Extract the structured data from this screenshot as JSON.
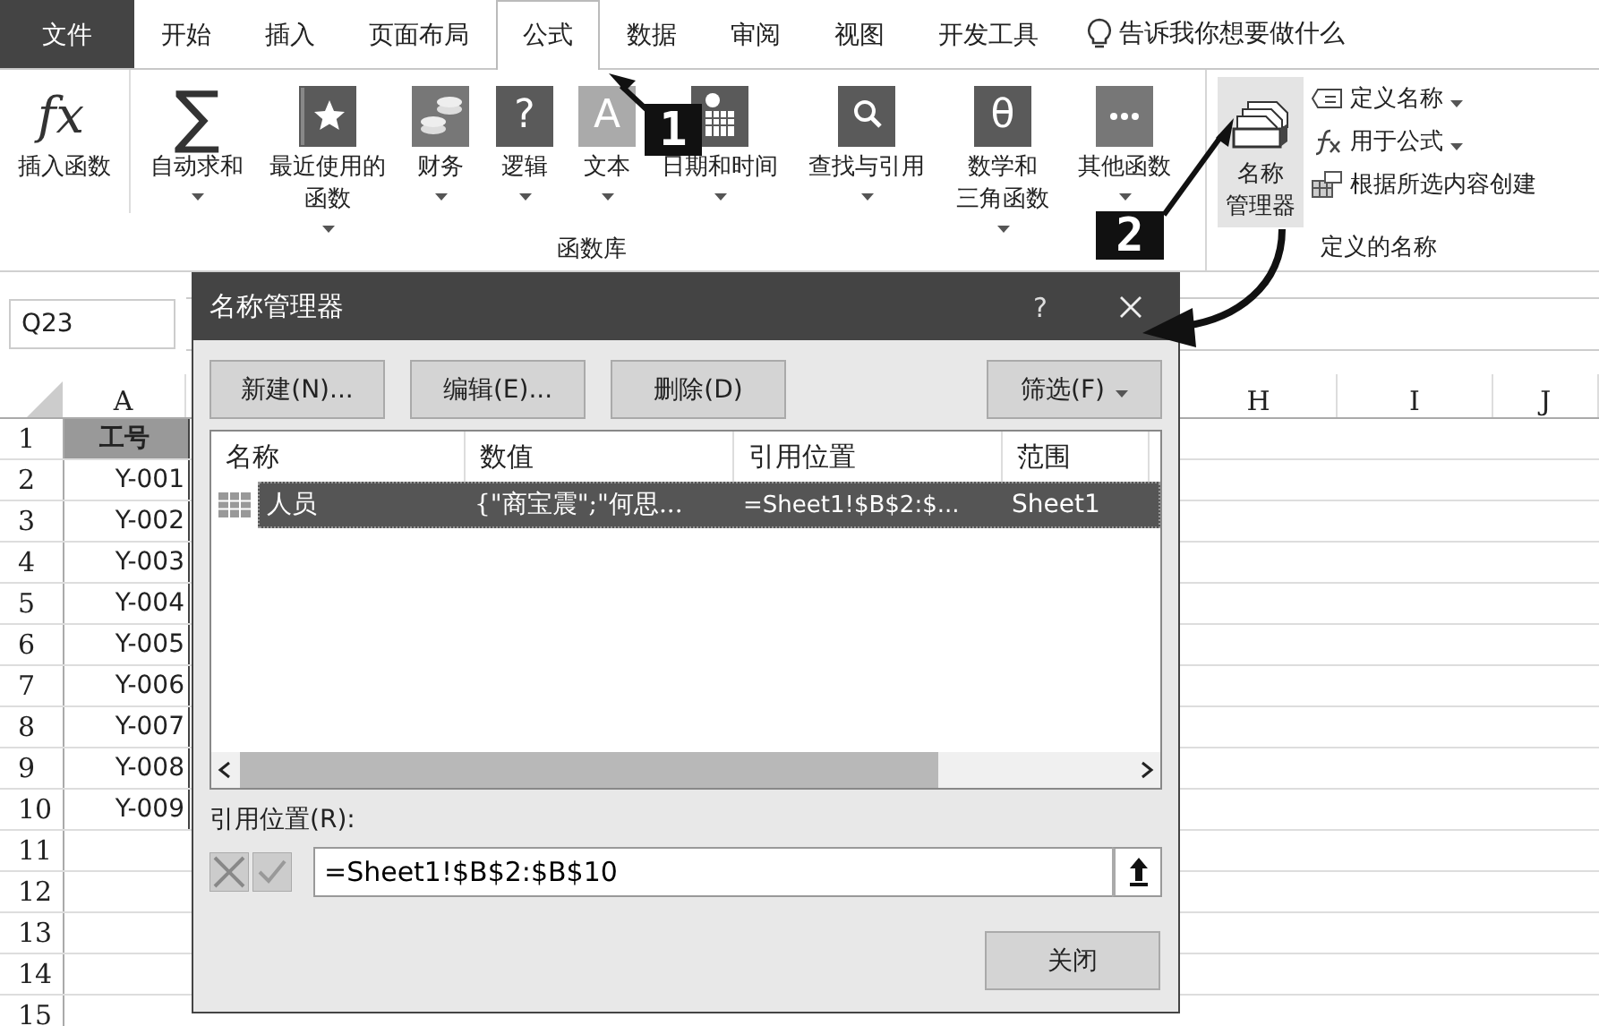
{
  "tabs": [
    {
      "label": "文件",
      "kind": "file",
      "selected": false
    },
    {
      "label": "开始",
      "kind": "tab",
      "selected": false
    },
    {
      "label": "插入",
      "kind": "tab",
      "selected": false
    },
    {
      "label": "页面布局",
      "kind": "tab",
      "selected": false
    },
    {
      "label": "公式",
      "kind": "tab",
      "selected": true
    },
    {
      "label": "数据",
      "kind": "tab",
      "selected": false
    },
    {
      "label": "审阅",
      "kind": "tab",
      "selected": false
    },
    {
      "label": "视图",
      "kind": "tab",
      "selected": false
    },
    {
      "label": "开发工具",
      "kind": "tab",
      "selected": false
    }
  ],
  "tell_me": "告诉我你想要做什么",
  "function_library": {
    "label": "函数库",
    "buttons": [
      {
        "kind": "fx",
        "glyph": "fx",
        "lines": [
          "插入函数"
        ],
        "dropdown": false
      },
      {
        "kind": "sigma",
        "glyph": "∑",
        "lines": [
          "自动求和"
        ],
        "dropdown": true
      },
      {
        "kind": "star",
        "lines": [
          "最近使用的",
          "函数"
        ],
        "dropdown": true
      },
      {
        "kind": "coins",
        "lines": [
          "财务"
        ],
        "dropdown": true
      },
      {
        "kind": "book",
        "glyph": "?",
        "lines": [
          "逻辑"
        ],
        "dropdown": true
      },
      {
        "kind": "faded",
        "glyph": "A",
        "lines": [
          "文本"
        ],
        "dropdown": true
      },
      {
        "kind": "calendar",
        "lines": [
          "日期和时间"
        ],
        "dropdown": true
      },
      {
        "kind": "search",
        "lines": [
          "查找与引用"
        ],
        "dropdown": true
      },
      {
        "kind": "book",
        "glyph": "θ",
        "lines": [
          "数学和",
          "三角函数"
        ],
        "dropdown": true
      },
      {
        "kind": "dots",
        "lines": [
          "其他函数"
        ],
        "dropdown": true
      }
    ]
  },
  "defined_names": {
    "label": "定义的名称",
    "name_manager": [
      "名称",
      "管理器"
    ],
    "items": [
      {
        "kind": "tag",
        "label": "定义名称",
        "dropdown": true
      },
      {
        "kind": "fx-small",
        "label": "用于公式",
        "dropdown": true
      },
      {
        "kind": "table",
        "label": "根据所选内容创建",
        "dropdown": false
      }
    ]
  },
  "name_box": "Q23",
  "columns": [
    "A",
    "H",
    "I",
    "J"
  ],
  "rows": [
    {
      "number": "1",
      "cell": "工号",
      "header": true
    },
    {
      "number": "2",
      "cell": "Y-001",
      "header": false
    },
    {
      "number": "3",
      "cell": "Y-002",
      "header": false
    },
    {
      "number": "4",
      "cell": "Y-003",
      "header": false
    },
    {
      "number": "5",
      "cell": "Y-004",
      "header": false
    },
    {
      "number": "6",
      "cell": "Y-005",
      "header": false
    },
    {
      "number": "7",
      "cell": "Y-006",
      "header": false
    },
    {
      "number": "8",
      "cell": "Y-007",
      "header": false
    },
    {
      "number": "9",
      "cell": "Y-008",
      "header": false
    },
    {
      "number": "10",
      "cell": "Y-009",
      "header": false
    },
    {
      "number": "11",
      "header": false
    },
    {
      "number": "12",
      "header": false
    },
    {
      "number": "13",
      "header": false
    },
    {
      "number": "14",
      "header": false
    },
    {
      "number": "15",
      "header": false
    }
  ],
  "dialog": {
    "title": "名称管理器",
    "help": "?",
    "buttons": [
      "新建(N)...",
      "编辑(E)...",
      "删除(D)"
    ],
    "filter": "筛选(F)",
    "columns": [
      "名称",
      "数值",
      "引用位置",
      "范围"
    ],
    "names": [
      {
        "name": "人员",
        "value": "{\"商宝震\";\"何思...",
        "refers_to": "=Sheet1!$B$2:$...",
        "scope": "Sheet1",
        "selected": true
      }
    ],
    "refers_label": "引用位置(R):",
    "refers_value": "=Sheet1!$B$2:$B$10",
    "close": "关闭"
  },
  "callouts": [
    "1",
    "2"
  ]
}
